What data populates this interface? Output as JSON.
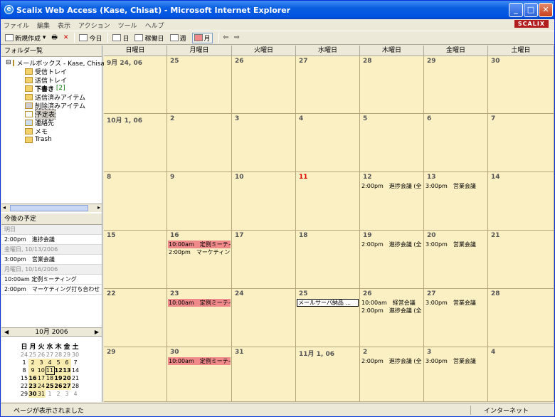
{
  "window": {
    "title": "Scalix Web Access (Kase, Chisat) - Microsoft Internet Explorer"
  },
  "menu": [
    "ファイル",
    "編集",
    "表示",
    "アクション",
    "ツール",
    "ヘルプ"
  ],
  "brand": "SCALIX",
  "toolbar": {
    "new": "新規作成",
    "today": "今日",
    "day": "日",
    "workweek": "稼働日",
    "week": "週",
    "month": "月"
  },
  "folders": {
    "header": "フォルダ一覧",
    "items": [
      "メールボックス - Kase, Chisato",
      "受信トレイ",
      "送信トレイ",
      "下書き",
      "[2]",
      "送信済みアイテム",
      "削除済みアイテム",
      "予定表",
      "連絡先",
      "メモ",
      "Trash"
    ]
  },
  "upcoming": {
    "header": "今後の予定",
    "rows": [
      {
        "type": "day",
        "text": "明日"
      },
      {
        "type": "ev",
        "text": "2:00pm　進捗会議"
      },
      {
        "type": "day",
        "text": "金曜日, 10/13/2006"
      },
      {
        "type": "ev",
        "text": "3:00pm　営業会議"
      },
      {
        "type": "day",
        "text": "月曜日, 10/16/2006"
      },
      {
        "type": "ev",
        "text": "10:00am 定例ミーティング"
      },
      {
        "type": "ev",
        "text": "2:00pm　マーケティング打ち合わせ"
      }
    ]
  },
  "minical": {
    "title": "10月 2006",
    "days": [
      "日",
      "月",
      "火",
      "水",
      "木",
      "金",
      "土"
    ]
  },
  "calendar": {
    "weekdays": [
      "日曜日",
      "月曜日",
      "火曜日",
      "水曜日",
      "木曜日",
      "金曜日",
      "土曜日"
    ],
    "weeks": [
      [
        {
          "d": "9月 24, 06"
        },
        {
          "d": "25"
        },
        {
          "d": "26"
        },
        {
          "d": "27"
        },
        {
          "d": "28"
        },
        {
          "d": "29"
        },
        {
          "d": "30"
        }
      ],
      [
        {
          "d": "10月 1, 06"
        },
        {
          "d": "2"
        },
        {
          "d": "3"
        },
        {
          "d": "4"
        },
        {
          "d": "5"
        },
        {
          "d": "6"
        },
        {
          "d": "7"
        }
      ],
      [
        {
          "d": "8"
        },
        {
          "d": "9"
        },
        {
          "d": "10"
        },
        {
          "d": "11",
          "today": true
        },
        {
          "d": "12",
          "ev": [
            {
              "t": "2:00pm　進捗会議 (全"
            }
          ]
        },
        {
          "d": "13",
          "ev": [
            {
              "t": "3:00pm　営業会議"
            }
          ]
        },
        {
          "d": "14"
        }
      ],
      [
        {
          "d": "15"
        },
        {
          "d": "16",
          "ev": [
            {
              "t": "10:00am　定例ミーティ",
              "pink": true
            },
            {
              "t": "2:00pm　マーケティン"
            }
          ]
        },
        {
          "d": "17"
        },
        {
          "d": "18"
        },
        {
          "d": "19",
          "ev": [
            {
              "t": "2:00pm　進捗会議 (全"
            }
          ]
        },
        {
          "d": "20",
          "ev": [
            {
              "t": "3:00pm　営業会議"
            }
          ]
        },
        {
          "d": "21"
        }
      ],
      [
        {
          "d": "22"
        },
        {
          "d": "23",
          "ev": [
            {
              "t": "10:00am　定例ミーティ",
              "pink": true
            }
          ]
        },
        {
          "d": "24"
        },
        {
          "d": "25",
          "ev": [
            {
              "t": "メールサーバ納品 ...",
              "box": true
            }
          ]
        },
        {
          "d": "26",
          "ev": [
            {
              "t": "10:00am　経営会議"
            },
            {
              "t": "2:00pm　進捗会議 (全"
            }
          ]
        },
        {
          "d": "27",
          "ev": [
            {
              "t": "3:00pm　営業会議"
            }
          ]
        },
        {
          "d": "28"
        }
      ],
      [
        {
          "d": "29"
        },
        {
          "d": "30",
          "ev": [
            {
              "t": "10:00am　定例ミーティ",
              "pink": true
            }
          ]
        },
        {
          "d": "31"
        },
        {
          "d": "11月 1, 06"
        },
        {
          "d": "2",
          "ev": [
            {
              "t": "2:00pm　進捗会議 (全"
            }
          ]
        },
        {
          "d": "3",
          "ev": [
            {
              "t": "3:00pm　営業会議"
            }
          ]
        },
        {
          "d": "4"
        }
      ]
    ]
  },
  "status": {
    "message": "ページが表示されました",
    "zone": "インターネット"
  }
}
